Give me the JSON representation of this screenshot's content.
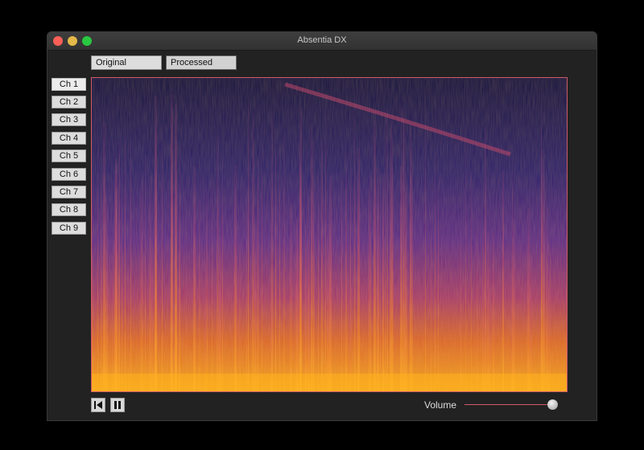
{
  "window": {
    "title": "Absentia DX"
  },
  "views": {
    "original_label": "Original",
    "processed_label": "Processed"
  },
  "channels": [
    {
      "label": "Ch 1",
      "active": true
    },
    {
      "label": "Ch 2"
    },
    {
      "label": "Ch 3"
    },
    {
      "label": "Ch 4"
    },
    {
      "label": "Ch 5"
    },
    {
      "label": "Ch 6"
    },
    {
      "label": "Ch 7"
    },
    {
      "label": "Ch 8"
    },
    {
      "label": "Ch 9"
    }
  ],
  "transport": {
    "rewind_icon": "skip-back-icon",
    "pause_icon": "pause-icon"
  },
  "volume": {
    "label": "Volume",
    "level": 0.95
  },
  "colors": {
    "spectrogram_low": "#19174a",
    "spectrogram_mid": "#8a2c8c",
    "spectrogram_high": "#f29a1a",
    "accent_line": "#d05a6a"
  }
}
